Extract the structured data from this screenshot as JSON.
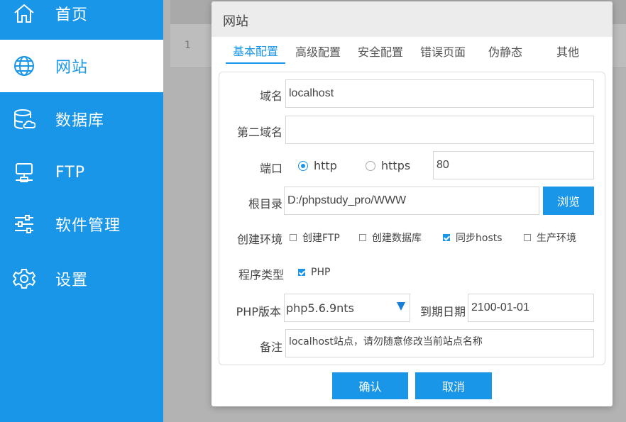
{
  "sidebar": {
    "items": [
      {
        "label": "首页",
        "icon": "home-icon"
      },
      {
        "label": "网站",
        "icon": "globe-icon",
        "active": true
      },
      {
        "label": "数据库",
        "icon": "database-icon"
      },
      {
        "label": "FTP",
        "icon": "ftp-icon"
      },
      {
        "label": "软件管理",
        "icon": "sliders-icon"
      },
      {
        "label": "设置",
        "icon": "gear-icon"
      }
    ]
  },
  "background_table": {
    "row_number": "1"
  },
  "dialog": {
    "title": "网站",
    "tabs": [
      {
        "label": "基本配置",
        "active": true
      },
      {
        "label": "高级配置"
      },
      {
        "label": "安全配置"
      },
      {
        "label": "错误页面"
      },
      {
        "label": "伪静态"
      },
      {
        "label": "其他"
      }
    ],
    "form": {
      "domain_label": "域名",
      "domain_value": "localhost",
      "second_domain_label": "第二域名",
      "second_domain_value": "",
      "port_label": "端口",
      "protocol_http": "http",
      "protocol_https": "https",
      "protocol_selected": "http",
      "port_value": "80",
      "root_label": "根目录",
      "root_value": "D:/phpstudy_pro/WWW",
      "browse_button": "浏览",
      "env_label": "创建环境",
      "env_options": [
        {
          "label": "创建FTP",
          "checked": false
        },
        {
          "label": "创建数据库",
          "checked": false
        },
        {
          "label": "同步hosts",
          "checked": true
        },
        {
          "label": "生产环境",
          "checked": false
        }
      ],
      "program_type_label": "程序类型",
      "program_type_option": "PHP",
      "program_type_checked": true,
      "php_version_label": "PHP版本",
      "php_version_value": "php5.6.9nts",
      "expire_label": "到期日期",
      "expire_value": "2100-01-01",
      "note_label": "备注",
      "note_value": "localhost站点，请勿随意修改当前站点名称"
    },
    "confirm_button": "确认",
    "cancel_button": "取消"
  },
  "colors": {
    "accent": "#1a96e9",
    "sidebar_bg": "#1a96e9",
    "dialog_header_bg": "#ececec"
  }
}
